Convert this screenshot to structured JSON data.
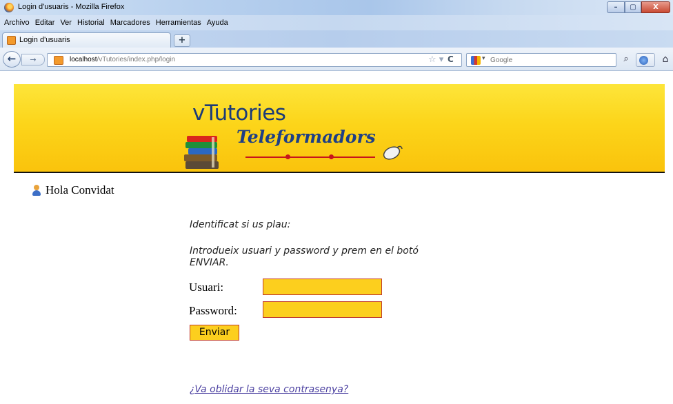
{
  "window": {
    "title": "Login d'usuaris - Mozilla Firefox",
    "controls": {
      "minimize": "–",
      "maximize": "▢",
      "close": "X"
    }
  },
  "menu": [
    "Archivo",
    "Editar",
    "Ver",
    "Historial",
    "Marcadores",
    "Herramientas",
    "Ayuda"
  ],
  "tab": {
    "label": "Login d'usuaris",
    "new_tab": "+"
  },
  "nav": {
    "url_host": "localhost",
    "url_path": "/vTutories/index.php/login",
    "search_placeholder": "Google"
  },
  "banner": {
    "brand": "vTutories",
    "subtitle": "Teleformadors"
  },
  "greeting": "Hola Convidat",
  "login": {
    "prompt": "Identificat si us plau:",
    "instructions": "Introdueix usuari y password y prem en el botó ENVIAR.",
    "user_label": "Usuari:",
    "password_label": "Password:",
    "user_value": "",
    "password_value": "",
    "submit_label": "Enviar",
    "forgot_link": "¿Va oblidar la seva contrasenya?"
  }
}
